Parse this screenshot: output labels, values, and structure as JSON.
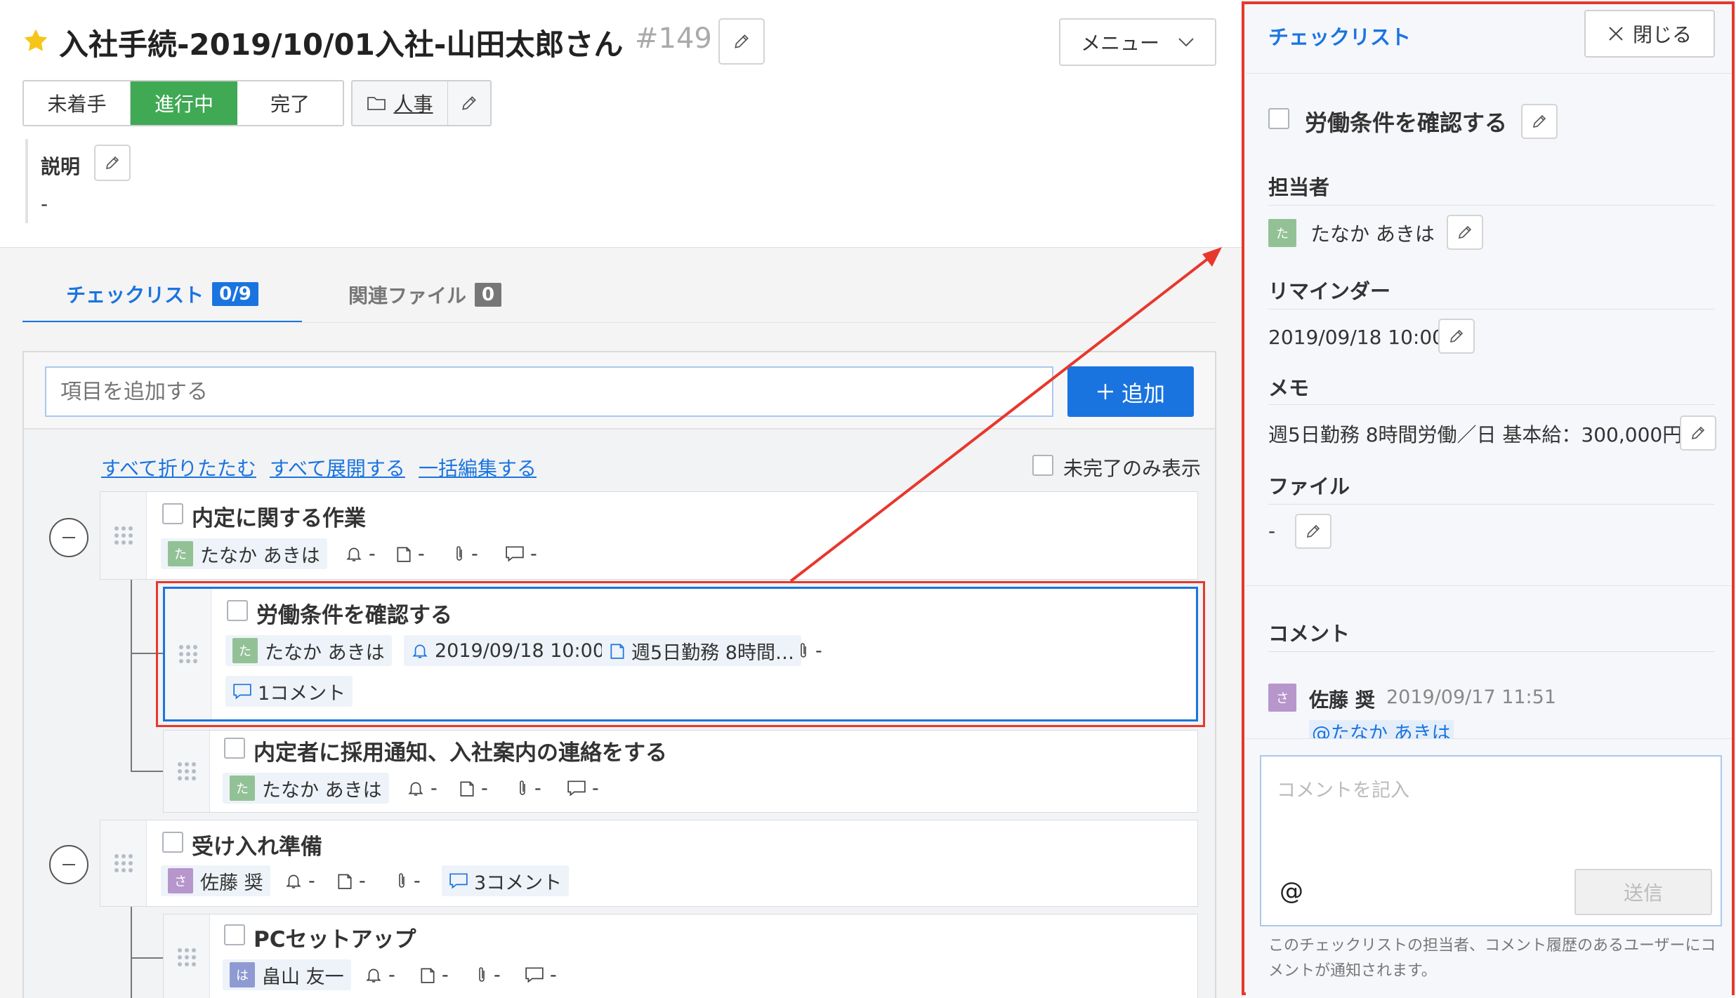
{
  "header": {
    "title": "入社手続-2019/10/01入社-山田太郎さん",
    "id_label": "#149",
    "menu_label": "メニュー"
  },
  "status": {
    "options": [
      "未着手",
      "進行中",
      "完了"
    ],
    "active": "進行中"
  },
  "category": {
    "label": "人事"
  },
  "description": {
    "label": "説明",
    "value": "-"
  },
  "tabs": [
    {
      "label": "チェックリスト",
      "badge": "0/9",
      "active": true
    },
    {
      "label": "関連ファイル",
      "badge": "0",
      "active": false
    }
  ],
  "add_item": {
    "placeholder": "項目を追加する",
    "button_label": "追加"
  },
  "actions": {
    "collapse_all": "すべて折りたたむ",
    "expand_all": "すべて展開する",
    "bulk_edit": "一括編集する",
    "show_incomplete": "未完了のみ表示"
  },
  "checklist": {
    "group1": {
      "title": "内定に関する作業",
      "assignee_initial": "た",
      "assignee": "たなか あきは",
      "reminder": "-",
      "memo": "-",
      "file": "-",
      "comment": "-"
    },
    "item1": {
      "title": "労働条件を確認する",
      "assignee_initial": "た",
      "assignee": "たなか あきは",
      "reminder": "2019/09/18 10:00",
      "memo": "週5日勤務 8時間…",
      "file": "-",
      "comment": "1コメント"
    },
    "item2": {
      "title": "内定者に採用通知、入社案内の連絡をする",
      "assignee_initial": "た",
      "assignee": "たなか あきは",
      "reminder": "-",
      "memo": "-",
      "file": "-",
      "comment": "-"
    },
    "group2": {
      "title": "受け入れ準備",
      "assignee_initial": "さ",
      "assignee": "佐藤 奨",
      "reminder": "-",
      "memo": "-",
      "file": "-",
      "comment": "3コメント"
    },
    "item3": {
      "title": "PCセットアップ",
      "assignee_initial": "は",
      "assignee": "畠山 友一",
      "reminder": "-",
      "memo": "-",
      "file": "-",
      "comment": "-"
    }
  },
  "panel": {
    "heading": "チェックリスト",
    "close_label": "閉じる",
    "item_title": "労働条件を確認する",
    "assignee_label": "担当者",
    "assignee_initial": "た",
    "assignee": "たなか あきは",
    "reminder_label": "リマインダー",
    "reminder": "2019/09/18 10:00",
    "memo_label": "メモ",
    "memo": "週5日勤務 8時間労働／日 基本給：300,000円",
    "file_label": "ファイル",
    "file": "-",
    "comment_label": "コメント",
    "comment_author_initial": "さ",
    "comment_author": "佐藤 奨",
    "comment_time": "2019/09/17 11:51",
    "comment_mention": "@たなか あきは",
    "comment_placeholder": "コメントを記入",
    "mention_symbol": "@",
    "send_label": "送信",
    "notice": "このチェックリストの担当者、コメント履歴のあるユーザーにコメントが通知されます。"
  },
  "colors": {
    "accent": "#1a74e0",
    "status_active": "#3fa954",
    "highlight": "#e8372c",
    "star": "#f5c518"
  }
}
